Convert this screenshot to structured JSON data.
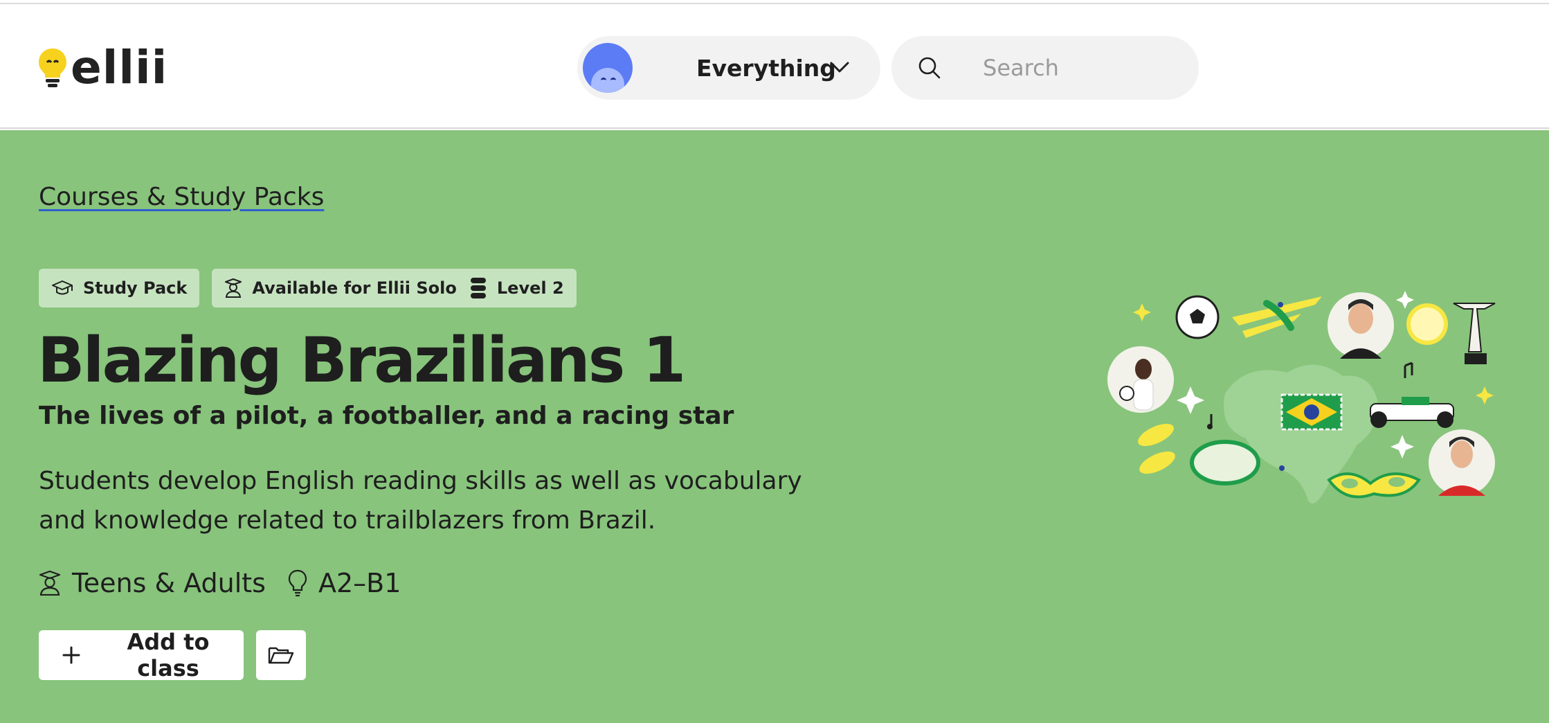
{
  "header": {
    "logo_text": "ellii",
    "scope_select": {
      "value": "Everything"
    },
    "search": {
      "placeholder": "Search"
    }
  },
  "hero": {
    "breadcrumb": "Courses & Study Packs",
    "tags": {
      "study_pack": "Study Pack",
      "availability": "Available for Ellii Solo",
      "level": "Level 2"
    },
    "title": "Blazing Brazilians 1",
    "subtitle": "The lives of a pilot, a footballer, and a racing star",
    "description": "Students develop English reading skills as well as vocabulary and knowledge related to trailblazers from Brazil.",
    "meta": {
      "audience": "Teens & Adults",
      "cefr": "A2–B1"
    },
    "actions": {
      "add_to_class": "Add to class"
    }
  },
  "colors": {
    "hero_bg": "#88c47c",
    "tag_bg": "#c6e3c0",
    "avatar_blue": "#5c7cf5",
    "logo_bulb": "#f6d11e",
    "link_underline": "#2f5fd0"
  }
}
